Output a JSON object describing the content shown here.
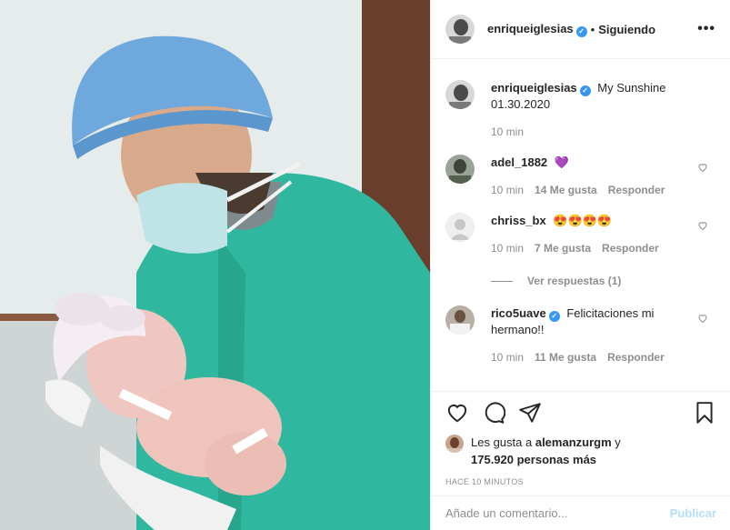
{
  "post": {
    "author": "enriqueiglesias",
    "follow_separator": "•",
    "follow_status": "Siguiendo",
    "more_icon": "more-horizontal-icon",
    "verified_icon": "verified-badge-icon"
  },
  "caption": {
    "username": "enriqueiglesias",
    "text_line1": "My Sunshine",
    "text_line2": "01.30.2020",
    "time": "10 min"
  },
  "comments": [
    {
      "username": "adel_1882",
      "text": "💜",
      "time": "10 min",
      "likes": "14 Me gusta",
      "reply": "Responder"
    },
    {
      "username": "chriss_bx",
      "text": "😍😍😍😍",
      "time": "10 min",
      "likes": "7 Me gusta",
      "reply": "Responder",
      "view_replies": "Ver respuestas (1)"
    },
    {
      "username": "rico5uave",
      "verified": true,
      "text": "Felicitaciones mi hermano!!",
      "time": "10 min",
      "likes": "11 Me gusta",
      "reply": "Responder"
    }
  ],
  "likes": {
    "prefix": "Les gusta a",
    "user": "alemanzurgm",
    "conj": "y",
    "count": "175.920 personas más"
  },
  "timestamp": "HACE 10 MINUTOS",
  "add_comment": {
    "placeholder": "Añade un comentario...",
    "publish": "Publicar"
  },
  "colors": {
    "verified": "#3897f0",
    "scrub": "#2fb89f",
    "cap": "#6fa8dc",
    "publish_disabled": "#b2dffc"
  }
}
